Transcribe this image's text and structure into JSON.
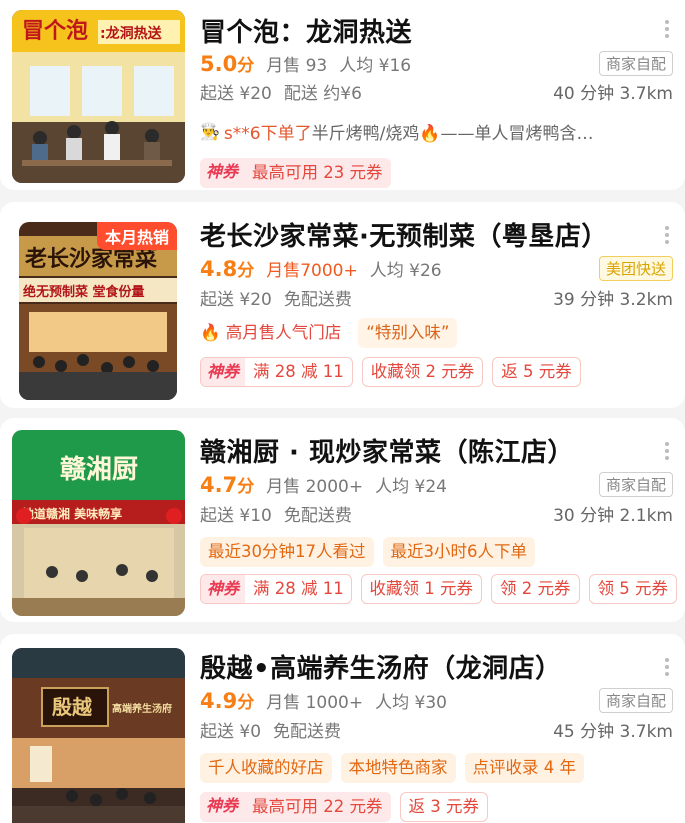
{
  "stores": [
    {
      "name": "冒个泡：龙洞热送",
      "score": "5.0",
      "score_unit": "分",
      "monthly_sales": "月售 93",
      "avg_price": "人均 ¥16",
      "delivery_type": "商家自配",
      "min_order": "起送 ¥20",
      "delivery_fee": "配送 约¥6",
      "time_distance": "40 分钟 3.7km",
      "review_user": "s**6下单了",
      "review_text": "半斤烤鸭/烧鸡🔥——单人冒烤鸭含…",
      "coupon_brand": "神券",
      "coupon_text": "最高可用 23 元券",
      "tags": []
    },
    {
      "name": "老长沙家常菜·无预制菜（粤垦店）",
      "ribbon": "本月热销",
      "score": "4.8",
      "score_unit": "分",
      "monthly_sales": "月售7000+",
      "avg_price": "人均 ¥26",
      "delivery_type": "美团快送",
      "min_order": "起送 ¥20",
      "delivery_fee": "免配送费",
      "time_distance": "39 分钟 3.2km",
      "highlights": [
        "高月售人气门店",
        "“特别入味”"
      ],
      "coupon_brand": "神券",
      "coupon_text": "满 28 减 11",
      "tags": [
        "收藏领 2 元券",
        "返 5 元券"
      ]
    },
    {
      "name": "赣湘厨 · 现炒家常菜（陈江店）",
      "score": "4.7",
      "score_unit": "分",
      "monthly_sales": "月售 2000+",
      "avg_price": "人均 ¥24",
      "delivery_type": "商家自配",
      "min_order": "起送 ¥10",
      "delivery_fee": "免配送费",
      "time_distance": "30 分钟 2.1km",
      "highlights": [
        "最近30分钟17人看过",
        "最近3小时6人下单"
      ],
      "coupon_brand": "神券",
      "coupon_text": "满 28 减 11",
      "tags": [
        "收藏领 1 元券",
        "领 2 元券",
        "领 5 元券"
      ]
    },
    {
      "name": "殷越•高端养生汤府（龙洞店）",
      "score": "4.9",
      "score_unit": "分",
      "monthly_sales": "月售 1000+",
      "avg_price": "人均 ¥30",
      "delivery_type": "商家自配",
      "min_order": "起送 ¥0",
      "delivery_fee": "免配送费",
      "time_distance": "45 分钟 3.7km",
      "highlights": [
        "千人收藏的好店",
        "本地特色商家",
        "点评收录 4 年"
      ],
      "coupon_brand": "神券",
      "coupon_text": "最高可用 22 元券",
      "tags": [
        "返 3 元券"
      ]
    }
  ],
  "sign_text": {
    "s1": "冒个泡",
    "s1b": ":龙洞热送",
    "s2": "老长沙家常菜",
    "s2b": "绝无预制菜 堂食份量",
    "s3": "赣湘厨",
    "s3b": "地道赣湘  美味畅享",
    "s4": "殷越",
    "s4b": "高端养生汤府"
  },
  "colors": {
    "accent": "#f67e14",
    "coupon_red": "#e4473c",
    "shenquan_bg": "#fde8ea"
  }
}
